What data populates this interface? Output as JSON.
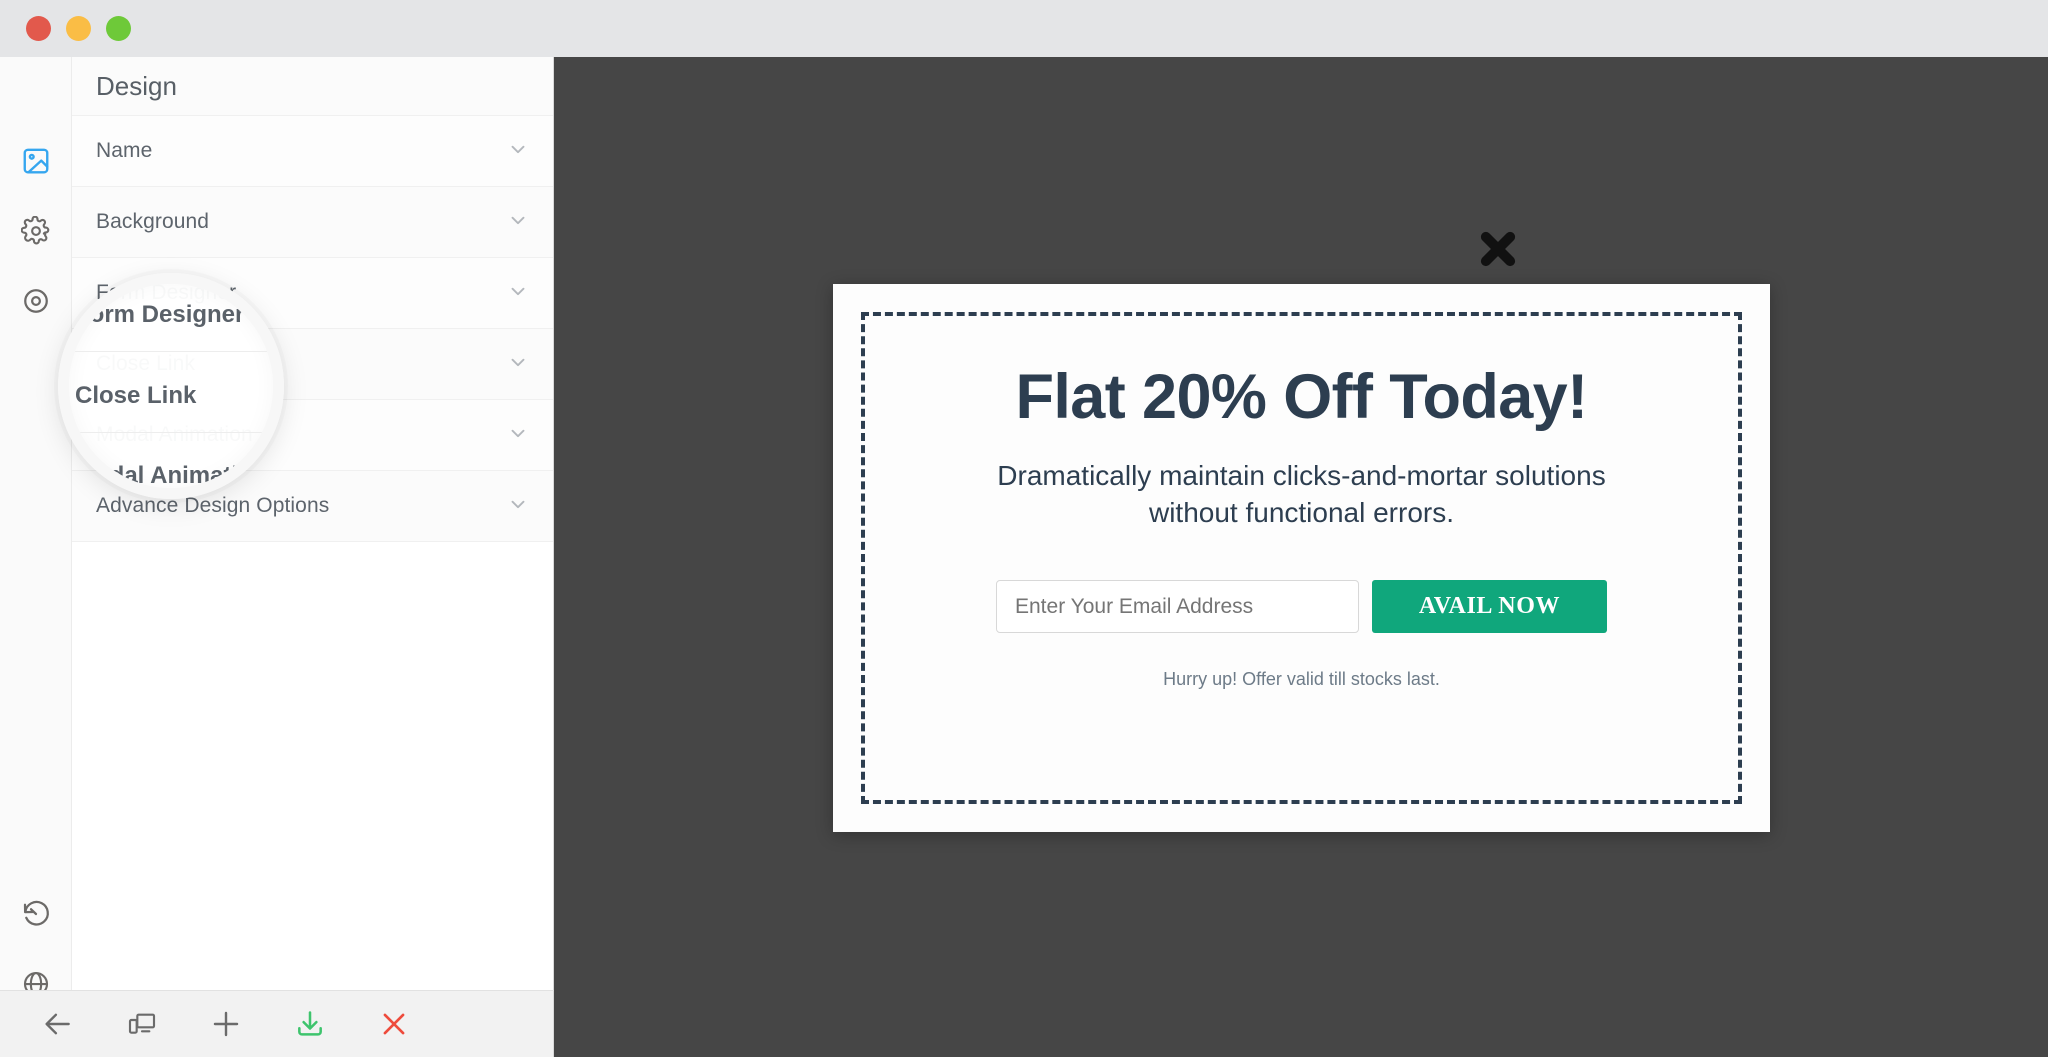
{
  "window": {
    "traffic_lights": [
      {
        "name": "close",
        "color": "#e2594c"
      },
      {
        "name": "minimize",
        "color": "#fabd45"
      },
      {
        "name": "zoom",
        "color": "#6ec939"
      }
    ]
  },
  "icon_rail": {
    "items": [
      {
        "icon": "image-icon",
        "active": true
      },
      {
        "icon": "gear-icon",
        "active": false
      },
      {
        "icon": "target-icon",
        "active": false
      }
    ],
    "bottom_items": [
      {
        "icon": "history-icon"
      },
      {
        "icon": "globe-icon"
      }
    ]
  },
  "panel": {
    "title": "Design",
    "sections": [
      {
        "label": "Name",
        "chevron": "chevron-down-icon"
      },
      {
        "label": "Background",
        "chevron": "chevron-down-icon"
      },
      {
        "label": "Form Designer",
        "chevron": "chevron-down-icon"
      },
      {
        "label": "Close Link",
        "chevron": "chevron-down-icon"
      },
      {
        "label": "Modal Animation",
        "chevron": "chevron-down-icon"
      },
      {
        "label": "Advance Design Options",
        "chevron": "chevron-down-icon"
      }
    ]
  },
  "lens": {
    "magnified": [
      "Form Designer",
      "Close Link",
      "Modal Animation"
    ]
  },
  "toolbar": {
    "buttons": [
      {
        "icon": "back-arrow-icon",
        "color": "#6b6b6b"
      },
      {
        "icon": "devices-icon",
        "color": "#6b6b6b"
      },
      {
        "icon": "plus-icon",
        "color": "#6b6b6b"
      },
      {
        "icon": "download-save-icon",
        "color": "#3ec46d"
      },
      {
        "icon": "close-x-icon",
        "color": "#ee4b3c"
      }
    ]
  },
  "canvas": {
    "background_color": "#464646"
  },
  "modal": {
    "heading": "Flat 20% Off Today!",
    "subtext": "Dramatically maintain clicks-and-mortar solutions without functional errors.",
    "email_placeholder": "Enter Your Email Address",
    "email_value": "",
    "cta_label": "AVAIL NOW",
    "note": "Hurry up! Offer valid till stocks last.",
    "close_icon": "close-x-icon",
    "accent_color": "#10a77c",
    "text_color": "#2d3e50",
    "border_style": "dashed"
  }
}
